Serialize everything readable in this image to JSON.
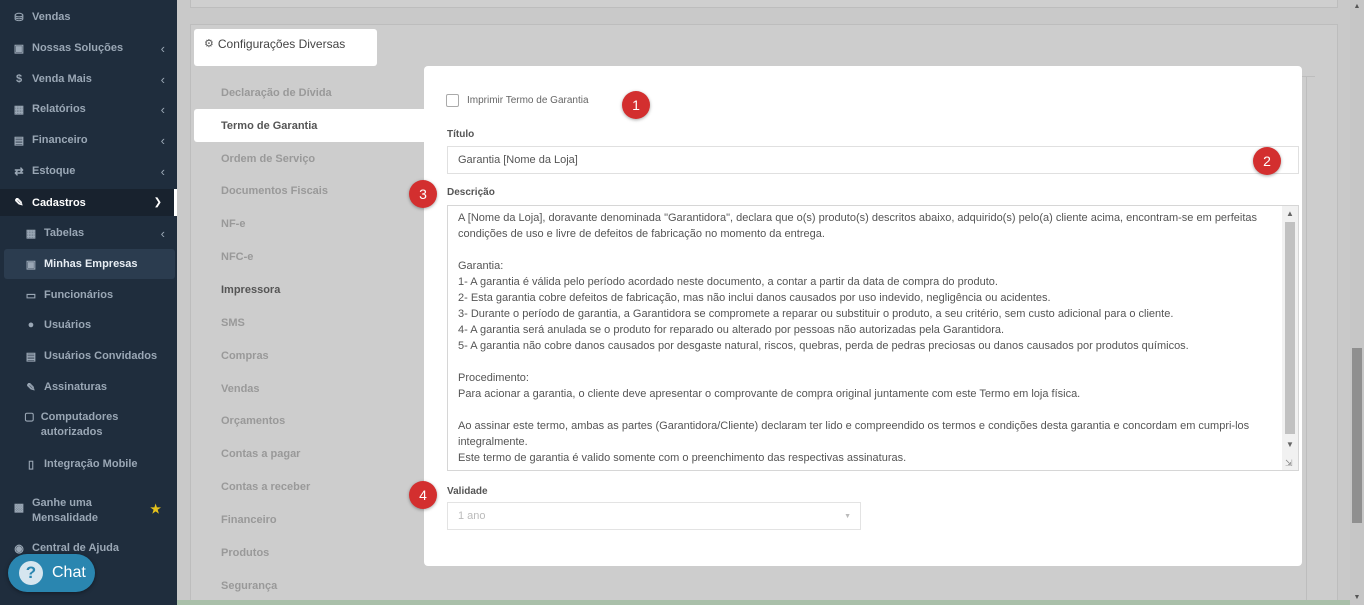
{
  "sidebar": {
    "items": [
      {
        "label": "Vendas",
        "icon": "basket-icon"
      },
      {
        "label": "Nossas Soluções",
        "icon": "building-icon"
      },
      {
        "label": "Venda Mais",
        "icon": "dollar-icon"
      },
      {
        "label": "Relatórios",
        "icon": "report-icon"
      },
      {
        "label": "Financeiro",
        "icon": "money-icon"
      },
      {
        "label": "Estoque",
        "icon": "arrows-icon"
      },
      {
        "label": "Cadastros",
        "icon": "edit-icon"
      },
      {
        "label": "Tabelas",
        "icon": "table-icon"
      },
      {
        "label": "Minhas Empresas",
        "icon": "building-icon"
      },
      {
        "label": "Funcionários",
        "icon": "folder-icon"
      },
      {
        "label": "Usuários",
        "icon": "users-icon"
      },
      {
        "label": "Usuários Convidados",
        "icon": "id-card-icon"
      },
      {
        "label": "Assinaturas",
        "icon": "signature-icon"
      },
      {
        "label": "Computadores autorizados",
        "icon": "monitor-icon"
      },
      {
        "label": "Integração Mobile",
        "icon": "mobile-icon"
      },
      {
        "label": "Ganhe uma Mensalidade",
        "icon": "gift-icon"
      },
      {
        "label": "Central de Ajuda",
        "icon": "question-icon"
      }
    ]
  },
  "chat": {
    "icon": "?",
    "label": "Chat"
  },
  "config": {
    "title": "Configurações Diversas",
    "menu": [
      "Declaração de Dívida",
      "Termo de Garantia",
      "Ordem de Serviço",
      "Documentos Fiscais",
      "NF-e",
      "NFC-e",
      "Impressora",
      "SMS",
      "Compras",
      "Vendas",
      "Orçamentos",
      "Contas a pagar",
      "Contas a receber",
      "Financeiro",
      "Produtos",
      "Segurança"
    ]
  },
  "modal": {
    "checkbox_label": "Imprimir Termo de Garantia",
    "titulo_label": "Título",
    "titulo_value": "Garantia [Nome da Loja]",
    "descricao_label": "Descrição",
    "descricao_value": "A [Nome da Loja], doravante denominada \"Garantidora\", declara que o(s) produto(s) descritos abaixo, adquirido(s) pelo(a) cliente acima, encontram-se em perfeitas condições de uso e livre de defeitos de fabricação no momento da entrega.\n\nGarantia:\n1- A garantia é válida pelo período acordado neste documento, a contar a partir da data de compra do produto.\n2- Esta garantia cobre defeitos de fabricação, mas não inclui danos causados por uso indevido, negligência ou acidentes.\n3- Durante o período de garantia, a Garantidora se compromete a reparar ou substituir o produto, a seu critério, sem custo adicional para o cliente.\n4- A garantia será anulada se o produto for reparado ou alterado por pessoas não autorizadas pela Garantidora.\n5- A garantia não cobre danos causados por desgaste natural, riscos, quebras, perda de pedras preciosas ou danos causados por produtos químicos.\n\nProcedimento:\nPara acionar a garantia, o cliente deve apresentar o comprovante de compra original juntamente com este Termo em loja física.\n\nAo assinar este termo, ambas as partes (Garantidora/Cliente) declaram ter lido e compreendido os termos e condições desta garantia e concordam em cumpri-los integralmente.\nEste termo de garantia é valido somente com o preenchimento das respectivas assinaturas.",
    "validade_label": "Validade",
    "validade_value": "1 ano"
  },
  "badges": [
    "1",
    "2",
    "3",
    "4"
  ]
}
